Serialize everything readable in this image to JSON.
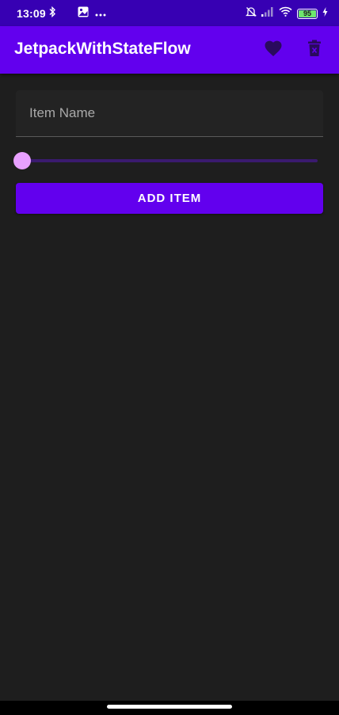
{
  "status_bar": {
    "time": "13:09",
    "battery": "95",
    "icons": [
      "bluetooth-icon",
      "gallery-notification-icon",
      "more-dots-icon",
      "dnd-icon",
      "signal-icon",
      "wifi-icon",
      "battery-icon",
      "charging-icon"
    ]
  },
  "app_bar": {
    "title": "JetpackWithStateFlow",
    "actions": [
      "favorite-icon",
      "delete-icon"
    ]
  },
  "form": {
    "item_name_label": "Item Name",
    "slider_value": 0,
    "add_button_label": "ADD ITEM"
  },
  "colors": {
    "primary": "#6200ee",
    "primary_variant": "#3700b3",
    "background": "#1e1e1e",
    "slider_thumb": "#e8a0ff"
  }
}
